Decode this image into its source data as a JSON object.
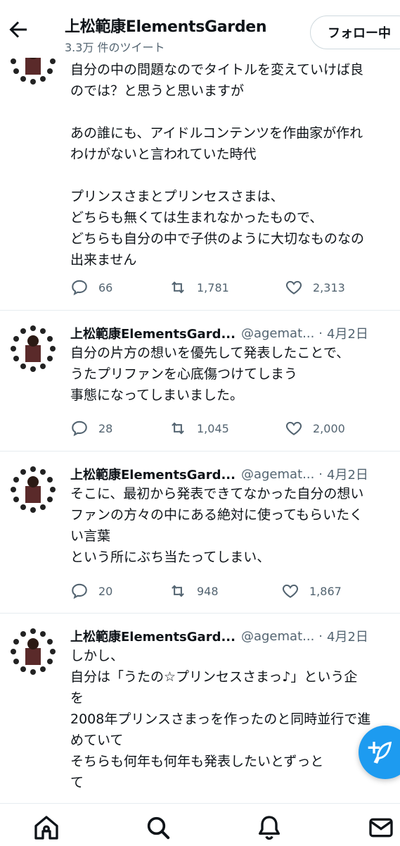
{
  "header": {
    "title": "上松範康ElementsGarden",
    "subtitle": "3.3万 件のツイート",
    "follow_label": "フォロー中",
    "icons": [
      "back-arrow-icon"
    ]
  },
  "tweets": [
    {
      "name": "",
      "handle": "",
      "date": "",
      "lines": [
        "自分の中の問題なのでタイトルを変えていけば良",
        "のでは？と思うと思いますが",
        "",
        "あの誰にも、アイドルコンテンツを作曲家が作れ",
        "わけがないと言われていた時代",
        "",
        "プリンスさまとプリンセスさまは、",
        "どちらも無くては生まれなかったもので、",
        "どちらも自分の中で子供のように大切なものなの",
        "出来ません"
      ],
      "replies": "66",
      "retweets": "1,781",
      "likes": "2,313"
    },
    {
      "name": "上松範康ElementsGard...",
      "handle": "@agemat...",
      "date": "4月2日",
      "lines": [
        "自分の片方の想いを優先して発表したことで、",
        "うたプリファンを心底傷つけてしまう",
        "事態になってしまいました。"
      ],
      "replies": "28",
      "retweets": "1,045",
      "likes": "2,000"
    },
    {
      "name": "上松範康ElementsGard...",
      "handle": "@agemat...",
      "date": "4月2日",
      "lines": [
        "そこに、最初から発表できてなかった自分の想い",
        "ファンの方々の中にある絶対に使ってもらいたく",
        "い言葉",
        "という所にぶち当たってしまい、"
      ],
      "replies": "20",
      "retweets": "948",
      "likes": "1,867"
    },
    {
      "name": "上松範康ElementsGard...",
      "handle": "@agemat...",
      "date": "4月2日",
      "lines": [
        "しかし、",
        "自分は「うたの☆プリンセスさまっ♪」という企",
        "を",
        "2008年プリンスさまっを作ったのと同時並行で進",
        "めていて",
        "そちらも何年も何年も発表したいとずっと",
        "て"
      ]
    }
  ],
  "fab_icon": "compose-tweet-icon",
  "bottom_nav": [
    "home-icon",
    "search-icon",
    "notifications-bell-icon",
    "messages-mail-icon"
  ],
  "colors": {
    "accent": "#1d9bf0",
    "secondary_text": "#536471",
    "divider": "#e6ecf0"
  }
}
